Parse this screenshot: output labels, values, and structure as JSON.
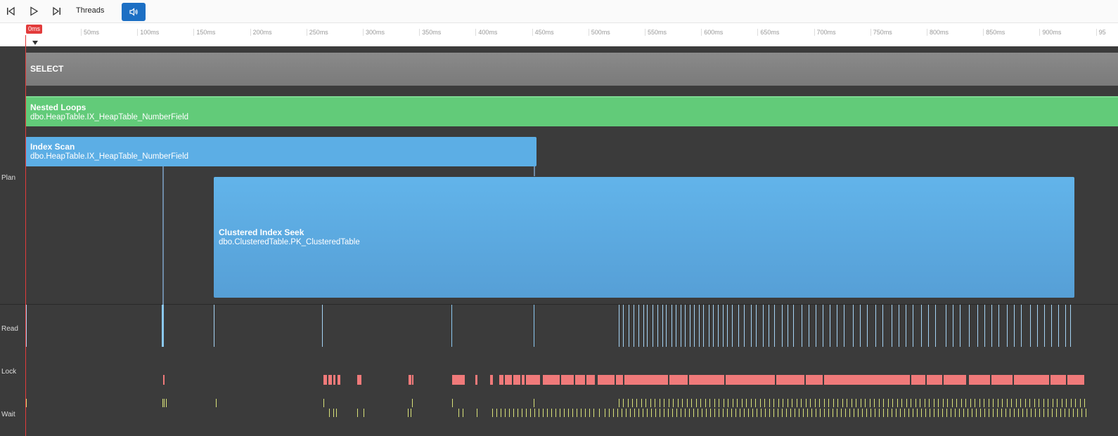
{
  "toolbar": {
    "threads_label": "Threads",
    "sound_active": true
  },
  "ruler": {
    "current_time": "0ms",
    "ticks": [
      "50ms",
      "100ms",
      "150ms",
      "200ms",
      "250ms",
      "300ms",
      "350ms",
      "400ms",
      "450ms",
      "500ms",
      "550ms",
      "600ms",
      "650ms",
      "700ms",
      "750ms",
      "800ms",
      "850ms",
      "900ms",
      "95"
    ]
  },
  "lanes": {
    "plan": "Plan",
    "read": "Read",
    "lock": "Lock",
    "wait": "Wait"
  },
  "operators": {
    "select": {
      "name": "SELECT",
      "object": ""
    },
    "nested_loops": {
      "name": "Nested Loops",
      "object": "dbo.HeapTable.IX_HeapTable_NumberField"
    },
    "index_scan": {
      "name": "Index Scan",
      "object": "dbo.HeapTable.IX_HeapTable_NumberField"
    },
    "clustered_index_seek": {
      "name": "Clustered Index Seek",
      "object": "dbo.ClusteredTable.PK_ClusteredTable"
    }
  },
  "colors": {
    "select": "#808080",
    "nested_loops": "#62cb79",
    "index_operator": "#5caee5",
    "playhead": "#e23b3b",
    "read_event": "#a6d4f5",
    "lock_event": "#f07a7a",
    "wait_event": "#d9e27a",
    "sound_button": "#1c6fc4"
  },
  "icons": {
    "skip_start": "skip-to-start-icon",
    "play": "play-icon",
    "skip_end": "skip-to-end-icon",
    "sound": "speaker-icon"
  }
}
